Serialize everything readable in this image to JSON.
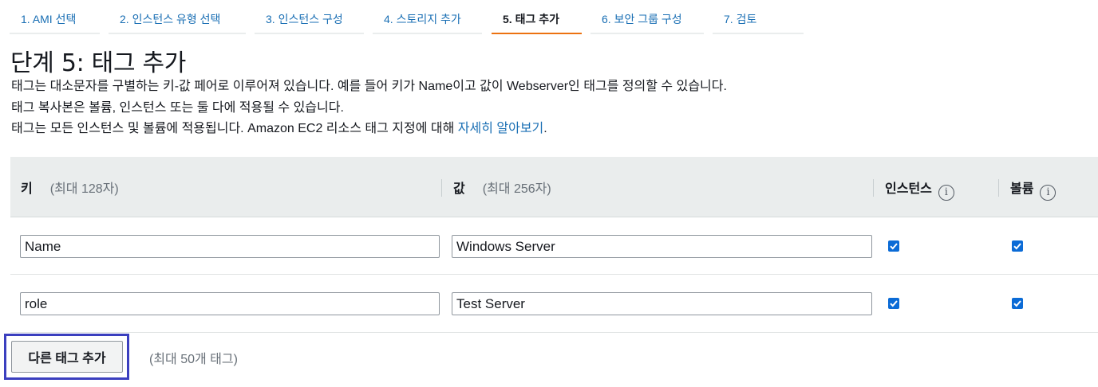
{
  "wizard": {
    "tabs": [
      {
        "label": "1. AMI 선택"
      },
      {
        "label": "2. 인스턴스 유형 선택"
      },
      {
        "label": "3. 인스턴스 구성"
      },
      {
        "label": "4. 스토리지 추가"
      },
      {
        "label": "5. 태그 추가",
        "active": true
      },
      {
        "label": "6. 보안 그룹 구성"
      },
      {
        "label": "7. 검토"
      }
    ]
  },
  "page": {
    "title": "단계 5: 태그 추가",
    "desc_line1": "태그는 대소문자를 구별하는 키-값 페어로 이루어져 있습니다. 예를 들어 키가 Name이고 값이 Webserver인 태그를 정의할 수 있습니다.",
    "desc_line2": "태그 복사본은 볼륨, 인스턴스 또는 둘 다에 적용될 수 있습니다.",
    "desc_line3": "태그는 모든 인스턴스 및 볼륨에 적용됩니다. Amazon EC2 리소스 태그 지정에 대해 ",
    "learn_more_link": "자세히 알아보기",
    "desc_line3_end": "."
  },
  "table": {
    "headers": {
      "key": "키",
      "key_hint": "(최대 128자)",
      "value": "값",
      "value_hint": "(최대 256자)",
      "instances": "인스턴스",
      "volumes": "볼륨"
    },
    "rows": [
      {
        "key": "Name",
        "value": "Windows Server",
        "instances": true,
        "volumes": true
      },
      {
        "key": "role",
        "value": "Test Server",
        "instances": true,
        "volumes": true
      }
    ]
  },
  "actions": {
    "add_tag_label": "다른 태그 추가",
    "max_tags": "(최대 50개 태그)"
  },
  "colors": {
    "link": "#1a6fb4",
    "active_tab_underline": "#ec7211",
    "checkbox": "#0b6bd6",
    "highlight_border": "#3b3fbf"
  }
}
